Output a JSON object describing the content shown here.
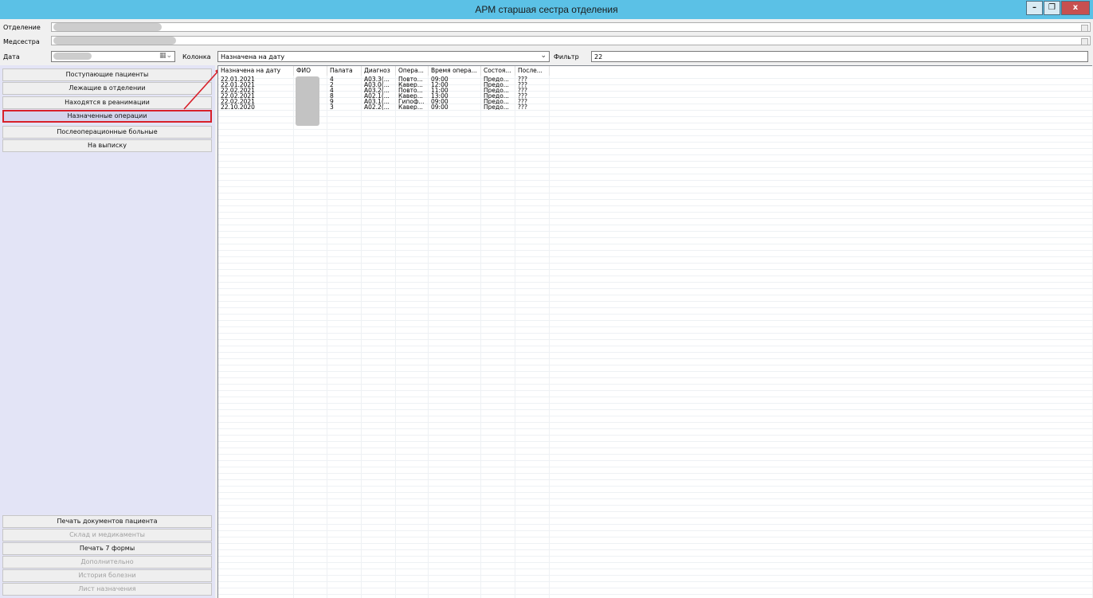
{
  "window": {
    "title": "АРМ старшая сестра отделения",
    "minimize": "–",
    "restore": "❐",
    "close": "x"
  },
  "fields": {
    "department_label": "Отделение",
    "nurse_label": "Медсестра",
    "date_label": "Дата",
    "column_label": "Колонка",
    "column_value": "Назначена на дату",
    "filter_label": "Фильтр",
    "filter_value": "22"
  },
  "nav": {
    "items": [
      {
        "label": "Поступающие пациенты",
        "state": "normal"
      },
      {
        "label": "Лежащие в отделении",
        "state": "normal"
      },
      {
        "label": "Находятся в реанимации",
        "state": "normal"
      },
      {
        "label": "Назначенные операции",
        "state": "selected"
      },
      {
        "label": "Послеоперационные больные",
        "state": "normal"
      },
      {
        "label": "На выписку",
        "state": "normal"
      }
    ],
    "bottom": [
      {
        "label": "Печать документов пациента",
        "state": "normal"
      },
      {
        "label": "Склад и медикаменты",
        "state": "disabled"
      },
      {
        "label": "Печать 7 формы",
        "state": "normal"
      },
      {
        "label": "Дополнительно",
        "state": "disabled"
      },
      {
        "label": "История болезни",
        "state": "disabled"
      },
      {
        "label": "Лист назначения",
        "state": "disabled"
      }
    ]
  },
  "table": {
    "columns": [
      "Назначена на дату",
      "ФИО",
      "Палата",
      "Диагноз",
      "Опера...",
      "Время опера...",
      "Состоя...",
      "После..."
    ],
    "rows": [
      [
        "22.01.2021",
        "",
        "4",
        "A03.3(...",
        "Повто...",
        "09:00",
        "Предо...",
        "???"
      ],
      [
        "22.01.2021",
        "",
        "2",
        "A03.0(...",
        "Кавер...",
        "12:00",
        "Предо...",
        "???"
      ],
      [
        "22.02.2021",
        "",
        "4",
        "A03.2(...",
        "Повто...",
        "11:00",
        "Предо...",
        "???"
      ],
      [
        "22.02.2021",
        "",
        "8",
        "A02.1(...",
        "Кавер...",
        "13:00",
        "Предо...",
        "???"
      ],
      [
        "22.02.2021",
        "",
        "9",
        "A03.1(...",
        "Гипоф...",
        "09:00",
        "Предо...",
        "???"
      ],
      [
        "22.10.2020",
        "",
        "3",
        "A02.2(...",
        "Кавер...",
        "09:00",
        "Предо...",
        "???"
      ]
    ]
  },
  "colors": {
    "titlebar": "#5bc1e6",
    "highlight": "#d8202a",
    "nav_panel": "#e3e4f6"
  }
}
